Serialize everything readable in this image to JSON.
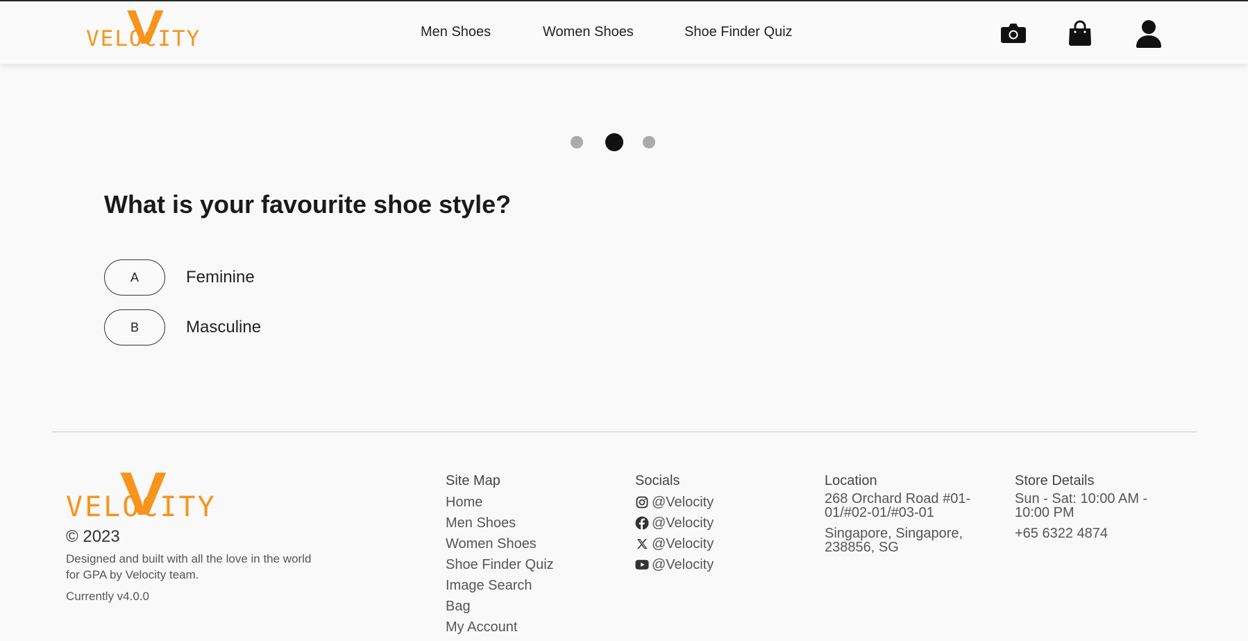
{
  "brand": {
    "name": "VELOCITY",
    "accent": "#f7941d"
  },
  "nav": {
    "items": [
      "Men Shoes",
      "Women Shoes",
      "Shoe Finder Quiz"
    ],
    "icons": [
      "camera-icon",
      "shopping-bag-icon",
      "user-icon"
    ]
  },
  "quiz": {
    "steps_total": 3,
    "current_step": 2,
    "question": "What is your favourite shoe style?",
    "options": [
      {
        "key": "A",
        "label": "Feminine"
      },
      {
        "key": "B",
        "label": "Masculine"
      }
    ]
  },
  "footer": {
    "copyright": "© 2023",
    "description": "Designed and built with all the love in the world for GPA by Velocity team.",
    "version": "Currently v4.0.0",
    "sitemap": {
      "title": "Site Map",
      "links": [
        "Home",
        "Men Shoes",
        "Women Shoes",
        "Shoe Finder Quiz",
        "Image Search",
        "Bag",
        "My Account"
      ]
    },
    "socials": {
      "title": "Socials",
      "items": [
        {
          "icon": "instagram-icon",
          "handle": "@Velocity"
        },
        {
          "icon": "facebook-icon",
          "handle": "@Velocity"
        },
        {
          "icon": "x-twitter-icon",
          "handle": "@Velocity"
        },
        {
          "icon": "youtube-icon",
          "handle": "@Velocity"
        }
      ]
    },
    "location": {
      "title": "Location",
      "line1": "268 Orchard Road #01-01/#02-01/#03-01",
      "line2": "Singapore, Singapore, 238856, SG"
    },
    "store": {
      "title": "Store Details",
      "hours": "Sun - Sat: 10:00 AM - 10:00 PM",
      "phone": "+65 6322 4874"
    }
  }
}
